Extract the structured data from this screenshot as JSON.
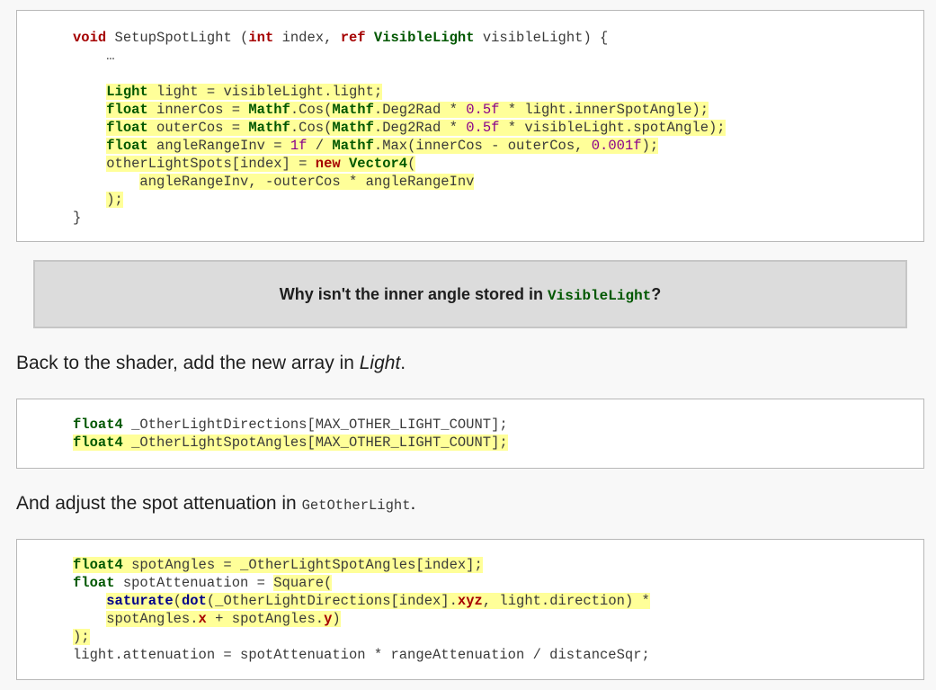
{
  "code_block_1": {
    "line_1": {
      "kw_void": "void",
      "name": " SetupSpotLight (",
      "kw_int": "int",
      "arg": " index, ",
      "kw_ref": "ref",
      "ty_visiblelight": "VisibleLight",
      "rest": " visibleLight) {"
    },
    "line_2": "…",
    "line_3": {
      "ty_light": "Light",
      "rest": " light = visibleLight.light;"
    },
    "line_4": {
      "kw_float": "float",
      "a": " innerCos = ",
      "mathf1": "Mathf",
      "b": ".Cos(",
      "mathf2": "Mathf",
      "c": ".Deg2Rad * ",
      "num": "0.5f",
      "d": " * light.innerSpotAngle);"
    },
    "line_5": {
      "kw_float": "float",
      "a": " outerCos = ",
      "mathf1": "Mathf",
      "b": ".Cos(",
      "mathf2": "Mathf",
      "c": ".Deg2Rad * ",
      "num": "0.5f",
      "d": " * visibleLight.spotAngle);"
    },
    "line_6": {
      "kw_float": "float",
      "a": " angleRangeInv = ",
      "num1": "1f",
      "b": " / ",
      "mathf": "Mathf",
      "c": ".Max(innerCos - outerCos, ",
      "num2": "0.001f",
      "d": ");"
    },
    "line_7": {
      "a": "otherLightSpots[index] = ",
      "kw_new": "new",
      "sp": " ",
      "ty_vector4": "Vector4",
      "b": "("
    },
    "line_8": "angleRangeInv, -outerCos * angleRangeInv",
    "line_9": ");",
    "line_10": "}"
  },
  "question": {
    "text": "Why isn't the inner angle stored in ",
    "code": "VisibleLight",
    "end": "?"
  },
  "para_1": {
    "text": "Back to the shader, add the new array in ",
    "em": "Light",
    "end": "."
  },
  "code_block_2": {
    "line_1": {
      "ty": "float4",
      "rest": " _OtherLightDirections[MAX_OTHER_LIGHT_COUNT];"
    },
    "line_2": {
      "ty": "float4",
      "rest": " _OtherLightSpotAngles[MAX_OTHER_LIGHT_COUNT];"
    }
  },
  "para_2": {
    "text": "And adjust the spot attenuation in ",
    "code": "GetOtherLight",
    "end": "."
  },
  "code_block_3": {
    "line_1": {
      "ty": "float4",
      "rest": " spotAngles = _OtherLightSpotAngles[index];"
    },
    "line_2": {
      "ty": "float",
      "a": " spotAttenuation = ",
      "b": "Square("
    },
    "line_3": {
      "fn_saturate": "saturate",
      "a": "(",
      "fn_dot": "dot",
      "b": "(_OtherLightDirections[index].",
      "kw_xyz": "xyz",
      "c": ", light.direction) ",
      "star": "*"
    },
    "line_4": {
      "a": "spotAngles.",
      "kw_x": "x",
      "b": " + spotAngles.",
      "kw_y": "y",
      "c": ")"
    },
    "line_5": ");",
    "line_6": "light.attenuation = spotAttenuation * rangeAttenuation / distanceSqr;"
  }
}
